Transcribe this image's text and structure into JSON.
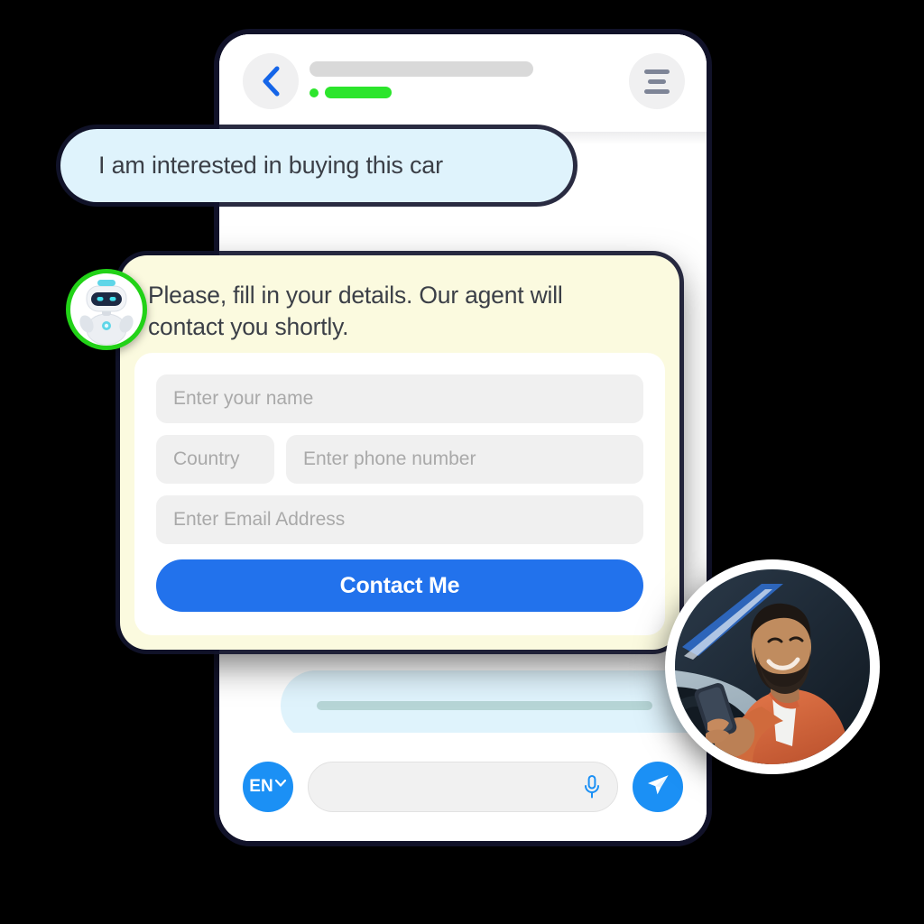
{
  "header": {
    "back_icon": "chevron-left-icon",
    "title_placeholder_bar": "",
    "status_placeholder_bar": "",
    "menu_icon": "hamburger-menu-icon"
  },
  "messages": [
    {
      "id": "user-message",
      "role": "user",
      "text": "I am interested in buying this car"
    },
    {
      "id": "skeleton-message",
      "role": "bot",
      "text": ""
    }
  ],
  "lead_form": {
    "avatar_icon": "robot-avatar-icon",
    "title": "Please, fill in your details. Our agent will contact you shortly.",
    "fields": {
      "name_placeholder": "Enter your name",
      "country_placeholder": "Country",
      "phone_placeholder": "Enter phone number",
      "email_placeholder": "Enter Email Address"
    },
    "submit_label": "Contact Me"
  },
  "composer": {
    "language": "EN",
    "language_chevron_icon": "chevron-down-icon",
    "input_value": "",
    "input_placeholder": "",
    "mic_icon": "microphone-icon",
    "send_icon": "send-paper-plane-icon"
  },
  "photo": {
    "alt": "man-in-car-using-phone"
  },
  "colors": {
    "accent_blue": "#2272ec",
    "light_blue": "#1b90f5",
    "bubble_blue": "#dff3fc",
    "form_cream": "#fbfadf",
    "status_green": "#22d217",
    "field_gray": "#f0f0f0"
  }
}
